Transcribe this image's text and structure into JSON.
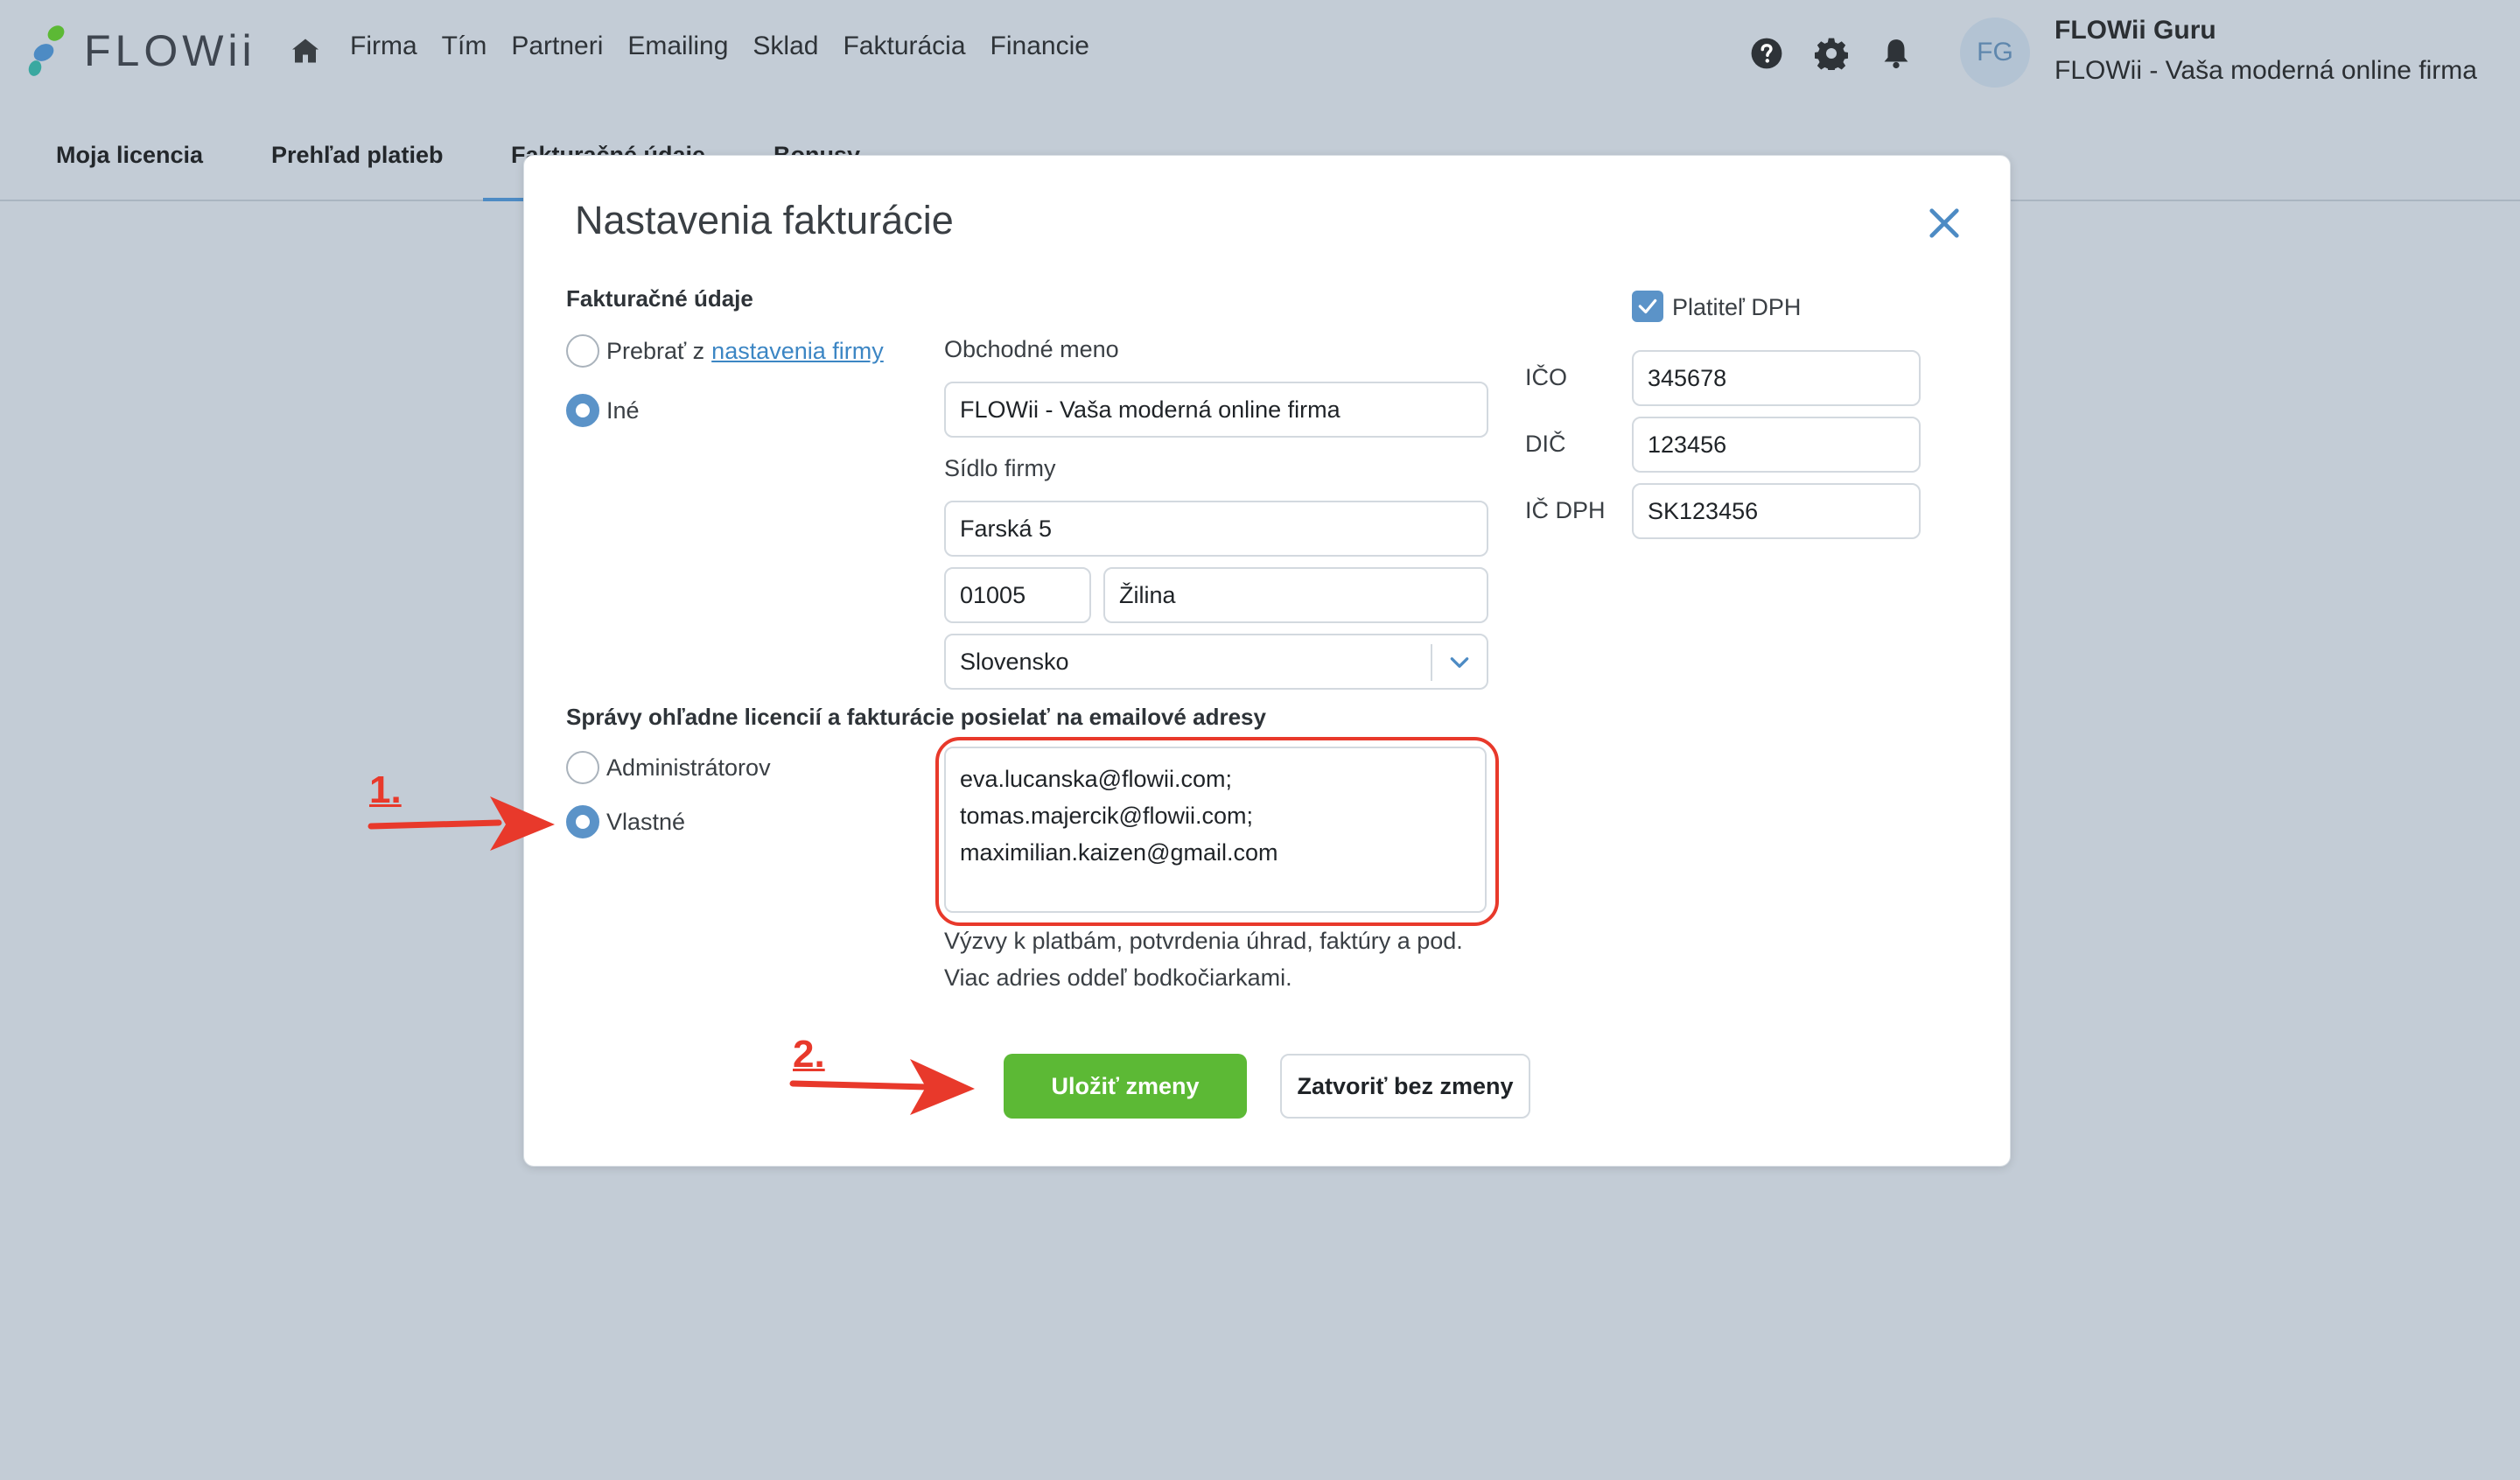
{
  "app": {
    "logo_text": "FLOWii",
    "nav": [
      "Firma",
      "Tím",
      "Partneri",
      "Emailing",
      "Sklad",
      "Fakturácia",
      "Financie"
    ],
    "user_initials": "FG",
    "user_name": "FLOWii Guru",
    "user_company": "FLOWii - Vaša moderná online firma",
    "icons": [
      "home-icon",
      "help-icon",
      "gear-icon",
      "bell-icon"
    ]
  },
  "subnav": {
    "tabs": [
      "Moja licencia",
      "Prehľad platieb",
      "Fakturačné údaje",
      "Bonusy"
    ],
    "active_tab": "Fakturačné údaje"
  },
  "modal": {
    "title": "Nastavenia fakturácie",
    "billing_section_label": "Fakturačné údaje",
    "source_option_prefix": "Prebrať z",
    "source_option_link": "nastavenia firmy",
    "other_option": "Iné",
    "business_name_label": "Obchodné meno",
    "business_name_value": "FLOWii - Vaša moderná online firma",
    "address_label": "Sídlo firmy",
    "street_value": "Farská 5",
    "zip_value": "01005",
    "city_value": "Žilina",
    "country_value": "Slovensko",
    "vat_payer_label": "Platiteľ DPH",
    "vat_payer_checked": true,
    "ico_label": "IČO",
    "ico_value": "345678",
    "dic_label": "DIČ",
    "dic_value": "123456",
    "icdph_label": "IČ DPH",
    "icdph_value": "SK123456",
    "emails_section_label": "Správy ohľadne licencií a fakturácie posielať na emailové adresy",
    "recipients_admins": "Administrátorov",
    "recipients_custom": "Vlastné",
    "emails": [
      "eva.lucanska@flowii.com;",
      "tomas.majercik@flowii.com;",
      "maximilian.kaizen@gmail.com"
    ],
    "hint_line1": "Výzvy k platbám, potvrdenia úhrad, faktúry a pod.",
    "hint_line2": "Viac adries oddeľ bodkočiarkami.",
    "save_button": "Uložiť zmeny",
    "close_button": "Zatvoriť bez zmeny"
  },
  "annotations": {
    "step1": "1.",
    "step2": "2.",
    "color": "#e8392b"
  },
  "colors": {
    "accent": "#5b93c8",
    "save": "#5cb935",
    "background": "#c3ccd6"
  }
}
